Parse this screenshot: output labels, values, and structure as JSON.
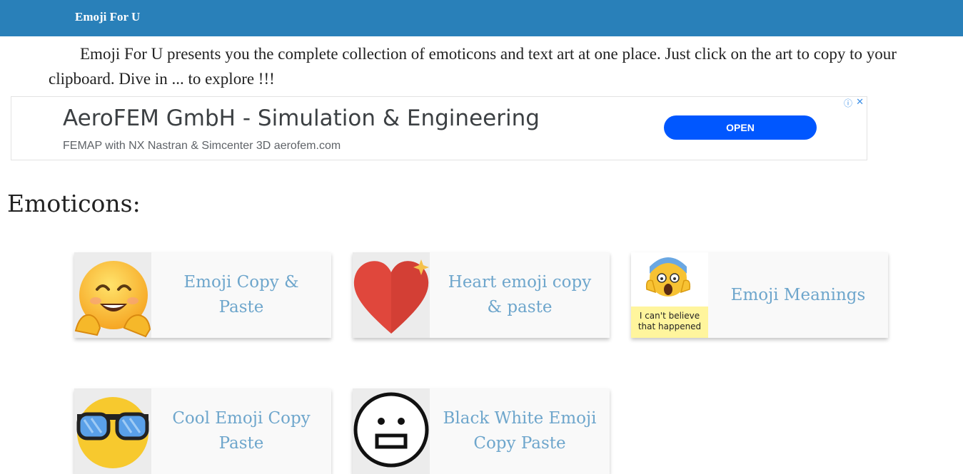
{
  "header": {
    "brand": "Emoji For U"
  },
  "intro": {
    "text": "Emoji For U presents you the complete collection of emoticons and text art at one place. Just click on the art to copy to your clipboard. Dive in ... to explore !!!"
  },
  "ad": {
    "title": "AeroFEM GmbH - Simulation & Engineering",
    "subtitle": "FEMAP with NX Nastran & Simcenter 3D aerofem.com",
    "button": "OPEN",
    "info_icon": "ⓘ",
    "close_icon": "✕"
  },
  "section": {
    "title": "Emoticons:"
  },
  "cards": [
    {
      "label": "Emoji Copy & Paste",
      "icon": "hugging-face-icon"
    },
    {
      "label": "Heart emoji copy & paste",
      "icon": "heart-icon"
    },
    {
      "label": "Emoji Meanings",
      "icon": "screaming-face-icon",
      "caption": "I can't believe that happened"
    },
    {
      "label": "Cool Emoji Copy Paste",
      "icon": "sunglasses-face-icon"
    },
    {
      "label": "Black White Emoji Copy Paste",
      "icon": "outline-face-icon"
    }
  ],
  "colors": {
    "header_bg": "#2980b9",
    "card_link": "#6ea6cc",
    "ad_button": "#0057ff"
  }
}
